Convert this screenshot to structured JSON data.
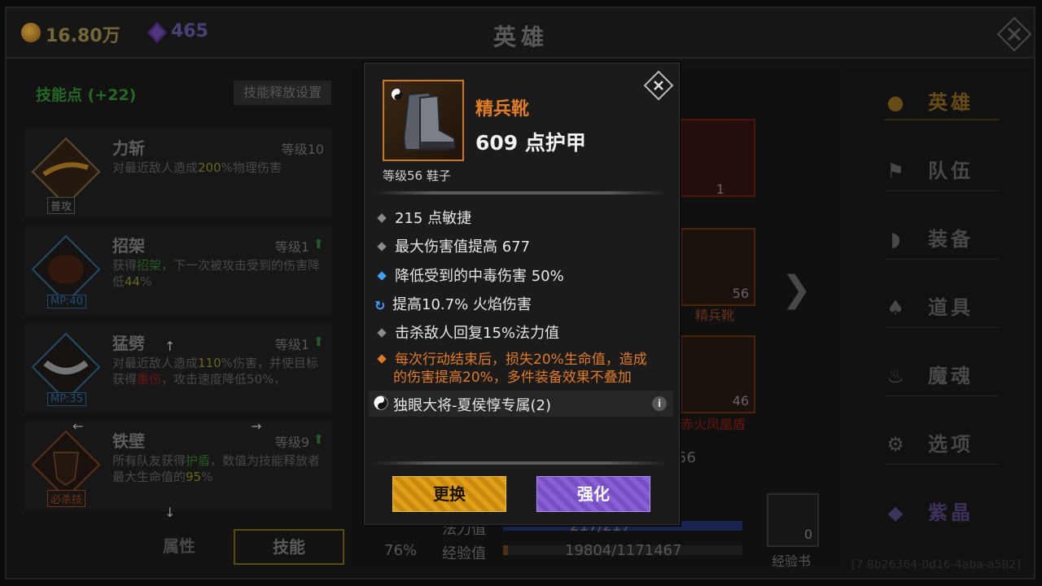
{
  "header": {
    "gold": "16.80万",
    "gems": "465",
    "title": "英雄"
  },
  "left": {
    "skill_points": "技能点 (+22)",
    "release_settings": "技能释放设置",
    "skills": [
      {
        "name": "力斩",
        "level": "等级10",
        "desc_pre": "对最近敌人造成",
        "desc_hl": "200",
        "desc_post": "%物理伤害",
        "desc2": "",
        "tag": "普攻"
      },
      {
        "name": "招架",
        "level": "等级1",
        "desc_pre": "获得",
        "desc_hl": "招架",
        "desc_post": "，下一次被攻击受到的伤害降低",
        "desc2": "44",
        "desc3": "%",
        "tag": "MP:40"
      },
      {
        "name": "猛劈",
        "level": "等级1",
        "desc_pre": "对最近敌人造成",
        "desc_hl": "110",
        "desc_post": "%伤害，并使目标获得",
        "desc2": "重伤",
        "desc3": "，攻击速度降低50%，",
        "tag": "MP:35"
      },
      {
        "name": "铁壁",
        "level": "等级9",
        "desc_pre": "所有队友获得",
        "desc_hl": "护盾",
        "desc_post": "，数值为技能释放者最大生命值的",
        "desc2": "95",
        "desc3": "%",
        "tag": "必杀技"
      }
    ],
    "tabs": {
      "attr": "属性",
      "skill": "技能"
    }
  },
  "middle": {
    "slot_top_count": "1",
    "boots_count": "56",
    "boots_name": "精兵靴",
    "shield_count": "46",
    "shield_name": "赤火凤凰盾",
    "partial_num": "56",
    "pct": "76%",
    "mp_label": "法力值",
    "mp_value": "217/217",
    "exp_label": "经验值",
    "exp_value": "19804/1171467",
    "book_count": "0",
    "book_label": "经验书"
  },
  "nav": {
    "items": [
      {
        "label": "英雄",
        "icon": "hero-icon"
      },
      {
        "label": "队伍",
        "icon": "flag-icon"
      },
      {
        "label": "装备",
        "icon": "helmet-icon"
      },
      {
        "label": "道具",
        "icon": "bag-icon"
      },
      {
        "label": "魔魂",
        "icon": "flame-icon"
      },
      {
        "label": "选项",
        "icon": "gear-icon"
      },
      {
        "label": "紫晶",
        "icon": "gem-icon"
      }
    ]
  },
  "watermark": "[7 8b26364-0d16-4aba-a582]",
  "modal": {
    "item_name": "精兵靴",
    "armor": "609 点护甲",
    "level_type": "等级56 鞋子",
    "attrs": [
      {
        "text": "215 点敏捷",
        "marker": "grey"
      },
      {
        "text": "最大伤害值提高 677",
        "marker": "grey"
      },
      {
        "text": "降低受到的中毒伤害 50%",
        "marker": "blue"
      },
      {
        "text": "提高10.7% 火焰伤害",
        "marker": "refresh"
      },
      {
        "text": "击杀敌人回复15%法力值",
        "marker": "grey"
      }
    ],
    "special_line1": "每次行动结束后，损失20%生命值，造成",
    "special_line2": "的伤害提高20%，多件装备效果不叠加",
    "set_name": "独眼大将-夏侯惇专属(2)",
    "btn_replace": "更换",
    "btn_enhance": "强化"
  },
  "colors": {
    "orange": "#e07a24",
    "gold_btn": "#e0a018",
    "purple_btn": "#8a60d6",
    "blue_marker": "#3ea0ff"
  }
}
